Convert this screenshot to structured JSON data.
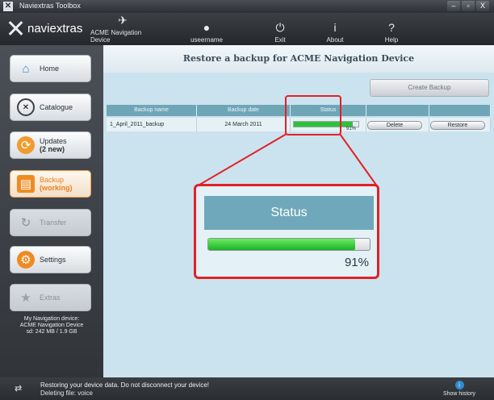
{
  "window": {
    "title": "Naviextras Toolbox"
  },
  "toolbar": {
    "logo_text": "naviextras",
    "items": [
      {
        "label": "ACME Navigation Device",
        "icon": "satellite-icon"
      },
      {
        "label": "useername",
        "icon": "user-icon"
      },
      {
        "label": "Exit",
        "icon": "power-icon"
      },
      {
        "label": "About",
        "icon": "info-icon"
      },
      {
        "label": "Help",
        "icon": "help-icon"
      }
    ]
  },
  "sidebar": {
    "items": [
      {
        "label": "Home",
        "state": "normal",
        "icon": "home-icon"
      },
      {
        "label": "Catalogue",
        "state": "normal",
        "icon": "catalogue-icon"
      },
      {
        "label": "Updates",
        "sub": "(2 new)",
        "state": "normal",
        "icon": "updates-icon"
      },
      {
        "label": "Backup",
        "sub": "(working)",
        "state": "active",
        "icon": "backup-icon"
      },
      {
        "label": "Transfer",
        "state": "disabled",
        "icon": "transfer-icon"
      },
      {
        "label": "Settings",
        "state": "normal",
        "icon": "settings-icon"
      },
      {
        "label": "Extras",
        "state": "disabled",
        "icon": "extras-icon"
      }
    ],
    "device_info": {
      "line1": "My Navigation device:",
      "line2": "ACME Navigation Device",
      "line3": "sd: 242 MB / 1.9 GB"
    }
  },
  "main": {
    "title": "Restore a backup for ACME Navigation Device",
    "create_backup_label": "Create Backup",
    "table": {
      "columns": [
        "Backup name",
        "Backup date",
        "Status",
        "",
        ""
      ],
      "rows": [
        {
          "name": "1_April_2011_backup",
          "date": "24 March 2011",
          "progress": 0.91,
          "progress_label": "91%",
          "delete_label": "Delete",
          "restore_label": "Restore"
        }
      ]
    },
    "zoom": {
      "header": "Status",
      "progress": 0.91,
      "progress_label": "91%"
    },
    "accent": "#e22126"
  },
  "statusbar": {
    "line1": "Restoring your device data. Do not disconnect your device!",
    "line2": "Deleting file: voice",
    "history_label": "Show history"
  }
}
